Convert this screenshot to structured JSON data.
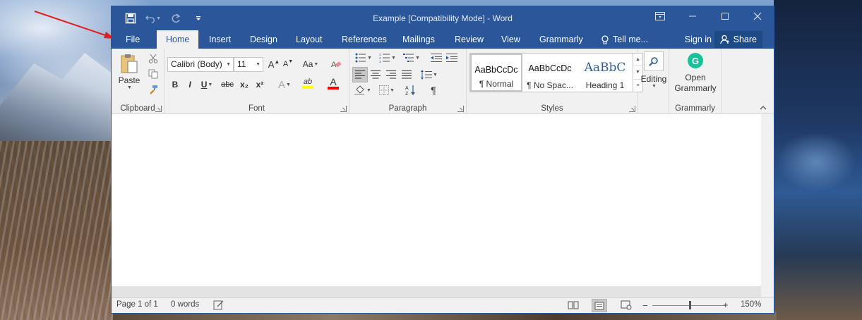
{
  "window": {
    "title": "Example [Compatibility Mode] - Word"
  },
  "quick_access": {
    "save_icon": "save-icon",
    "undo_icon": "undo-icon",
    "redo_icon": "redo-icon",
    "customize_icon": "customize-qat-icon"
  },
  "tabs": {
    "file": "File",
    "home": "Home",
    "insert": "Insert",
    "design": "Design",
    "layout": "Layout",
    "references": "References",
    "mailings": "Mailings",
    "review": "Review",
    "view": "View",
    "grammarly": "Grammarly",
    "tell_me": "Tell me...",
    "sign_in": "Sign in",
    "share": "Share"
  },
  "ribbon": {
    "clipboard": {
      "label": "Clipboard",
      "paste": "Paste"
    },
    "font": {
      "label": "Font",
      "font_name": "Calibri (Body)",
      "font_size": "11",
      "change_case": "Aa",
      "bold": "B",
      "italic": "I",
      "underline": "U",
      "strike": "abc",
      "subscript": "x₂",
      "superscript": "x²",
      "text_effects": "A",
      "highlight": "ab",
      "font_color": "A",
      "highlight_color": "#ffff00",
      "font_color_value": "#ff0000"
    },
    "paragraph": {
      "label": "Paragraph"
    },
    "styles": {
      "label": "Styles",
      "items": [
        {
          "sample": "AaBbCcDc",
          "name": "¶ Normal"
        },
        {
          "sample": "AaBbCcDc",
          "name": "¶ No Spac..."
        },
        {
          "sample": "AaBbC",
          "name": "Heading 1"
        }
      ]
    },
    "editing": {
      "label": "Editing"
    },
    "grammarly": {
      "label": "Grammarly",
      "open_line1": "Open",
      "open_line2": "Grammarly",
      "brand_color": "#15c39a"
    }
  },
  "status": {
    "page": "Page 1 of 1",
    "words": "0 words",
    "zoom": "150%"
  },
  "colors": {
    "word_blue": "#2b579a"
  }
}
